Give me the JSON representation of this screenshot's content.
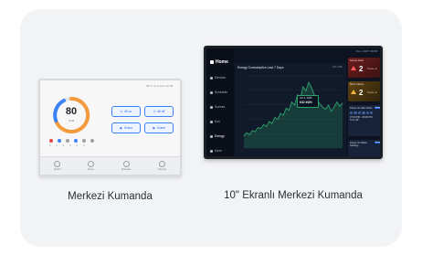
{
  "products": [
    {
      "caption": "Merkezi Kumanda",
      "device": {
        "status_bar": "08:17 11 ● auto 19 ℃",
        "gauge": {
          "value": "80",
          "caption": "Total"
        },
        "buttons": [
          "All on",
          "All off",
          "Scene",
          "Scene"
        ],
        "mode_numbers": [
          "0",
          "0",
          "0",
          "0",
          "0",
          "0"
        ],
        "footer": [
          "Switch",
          "Scene",
          "Schedule",
          "Security"
        ]
      }
    },
    {
      "caption": "10\" Ekranlı Merkezi Kumanda",
      "device": {
        "status_bar": "Oct 1, 2025  7:18 PM",
        "nav": [
          "Home",
          "Devices",
          "Schedule",
          "Scenes",
          "Eco",
          "Energy",
          "More"
        ],
        "chart": {
          "title": "Energy Consumption Last 7 Days",
          "unit": "Unit: kWh",
          "tooltip_date": "Oct 1, 2025",
          "tooltip_value": "642 kWh"
        },
        "alerts": [
          {
            "title": "Severe Fault",
            "count": "2",
            "unit": "Times",
            "delta": "+2"
          },
          {
            "title": "Minor Failure",
            "count": "2",
            "unit": "Times",
            "delta": "+2"
          }
        ],
        "schedules": [
          {
            "title": "Power On After Work",
            "tag": "To do",
            "time": "07:00 PM - 08:00 PM",
            "action": "Turn Off"
          },
          {
            "title": "Power On When Starting...",
            "tag": "To do"
          }
        ]
      }
    }
  ],
  "colors": {
    "accent_blue": "#3b82f6",
    "chart_line": "#2ca36a",
    "fault_red": "#ff5a5a",
    "warn_amber": "#f2b53d"
  },
  "chart_data": {
    "type": "area",
    "title": "Energy Consumption Last 7 Days",
    "xlabel": "",
    "ylabel": "",
    "series": [
      {
        "values": [
          120,
          150,
          130,
          170,
          160,
          200,
          190,
          230,
          210,
          260,
          240,
          300,
          280,
          340,
          320,
          390,
          370,
          450,
          420,
          520,
          480,
          600,
          560,
          642,
          590,
          520,
          470,
          430,
          400,
          380,
          420,
          360,
          400,
          450,
          410,
          440
        ]
      }
    ],
    "tooltip": {
      "date": "Oct 1, 2025",
      "value": "642 kWh"
    },
    "grid": true
  }
}
